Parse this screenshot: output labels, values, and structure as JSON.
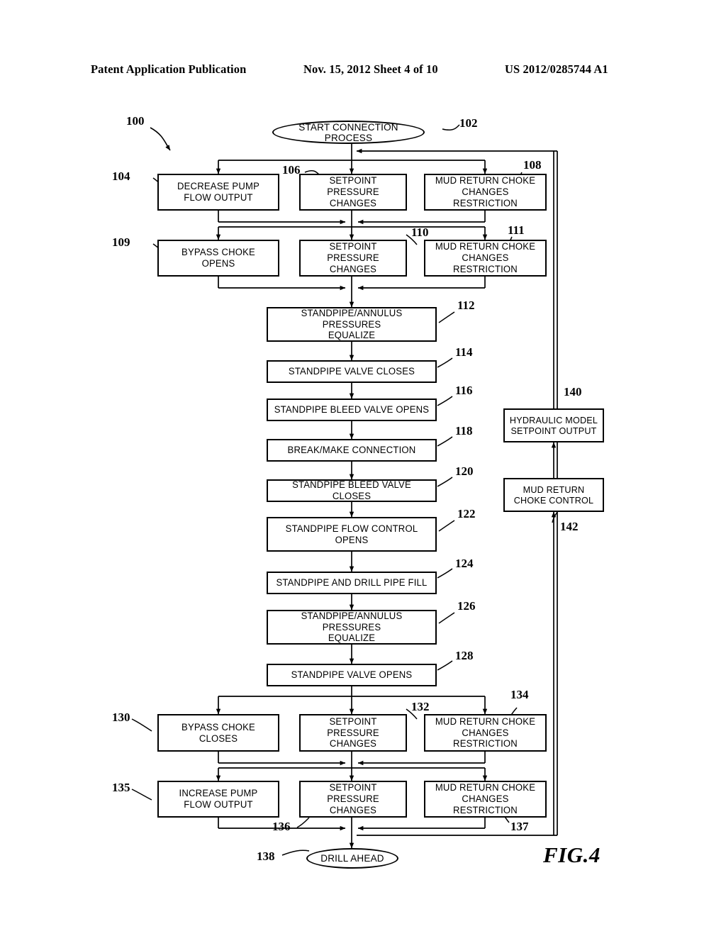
{
  "header": {
    "publication": "Patent Application Publication",
    "date_sheet": "Nov. 15, 2012  Sheet 4 of 10",
    "patent_number": "US 2012/0285744 A1"
  },
  "figure": {
    "caption": "FIG.4",
    "diagram_label": "100",
    "type": "flowchart",
    "title": "Connection process flow diagram"
  },
  "nodes": {
    "start": {
      "ref": "102",
      "label": "START  CONNECTION  PROCESS",
      "shape": "ellipse"
    },
    "n104": {
      "ref": "104",
      "label": "DECREASE  PUMP\nFLOW  OUTPUT"
    },
    "n106": {
      "ref": "106",
      "label": "SETPOINT  PRESSURE\nCHANGES"
    },
    "n108": {
      "ref": "108",
      "label": "MUD  RETURN  CHOKE\nCHANGES  RESTRICTION"
    },
    "n109": {
      "ref": "109",
      "label": "BYPASS  CHOKE\nOPENS"
    },
    "n110": {
      "ref": "110",
      "label": "SETPOINT  PRESSURE\nCHANGES"
    },
    "n111": {
      "ref": "111",
      "label": "MUD  RETURN  CHOKE\nCHANGES  RESTRICTION"
    },
    "n112": {
      "ref": "112",
      "label": "STANDPIPE/ANNULUS  PRESSURES\nEQUALIZE"
    },
    "n114": {
      "ref": "114",
      "label": "STANDPIPE  VALVE  CLOSES"
    },
    "n116": {
      "ref": "116",
      "label": "STANDPIPE  BLEED  VALVE  OPENS"
    },
    "n118": {
      "ref": "118",
      "label": "BREAK/MAKE  CONNECTION"
    },
    "n120": {
      "ref": "120",
      "label": "STANDPIPE  BLEED  VALVE  CLOSES"
    },
    "n122": {
      "ref": "122",
      "label": "STANDPIPE  FLOW  CONTROL\nOPENS"
    },
    "n124": {
      "ref": "124",
      "label": "STANDPIPE  AND  DRILL  PIPE  FILL"
    },
    "n126": {
      "ref": "126",
      "label": "STANDPIPE/ANNULUS  PRESSURES\nEQUALIZE"
    },
    "n128": {
      "ref": "128",
      "label": "STANDPIPE  VALVE  OPENS"
    },
    "n130": {
      "ref": "130",
      "label": "BYPASS  CHOKE\nCLOSES"
    },
    "n132": {
      "ref": "132",
      "label": "SETPOINT  PRESSURE\nCHANGES"
    },
    "n134": {
      "ref": "134",
      "label": "MUD  RETURN  CHOKE\nCHANGES  RESTRICTION"
    },
    "n135": {
      "ref": "135",
      "label": "INCREASE  PUMP\nFLOW  OUTPUT"
    },
    "n136": {
      "ref": "136",
      "label": "SETPOINT  PRESSURE\nCHANGES"
    },
    "n137": {
      "ref": "137",
      "label": "MUD  RETURN  CHOKE\nCHANGES  RESTRICTION"
    },
    "n138": {
      "ref": "138",
      "label": "DRILL  AHEAD",
      "shape": "ellipse"
    },
    "n140": {
      "ref": "140",
      "label": "HYDRAULIC  MODEL\nSETPOINT  OUTPUT"
    },
    "n142": {
      "ref": "142",
      "label": "MUD  RETURN\nCHOKE  CONTROL"
    }
  },
  "colors": {
    "ink": "#000000",
    "paper": "#ffffff"
  }
}
